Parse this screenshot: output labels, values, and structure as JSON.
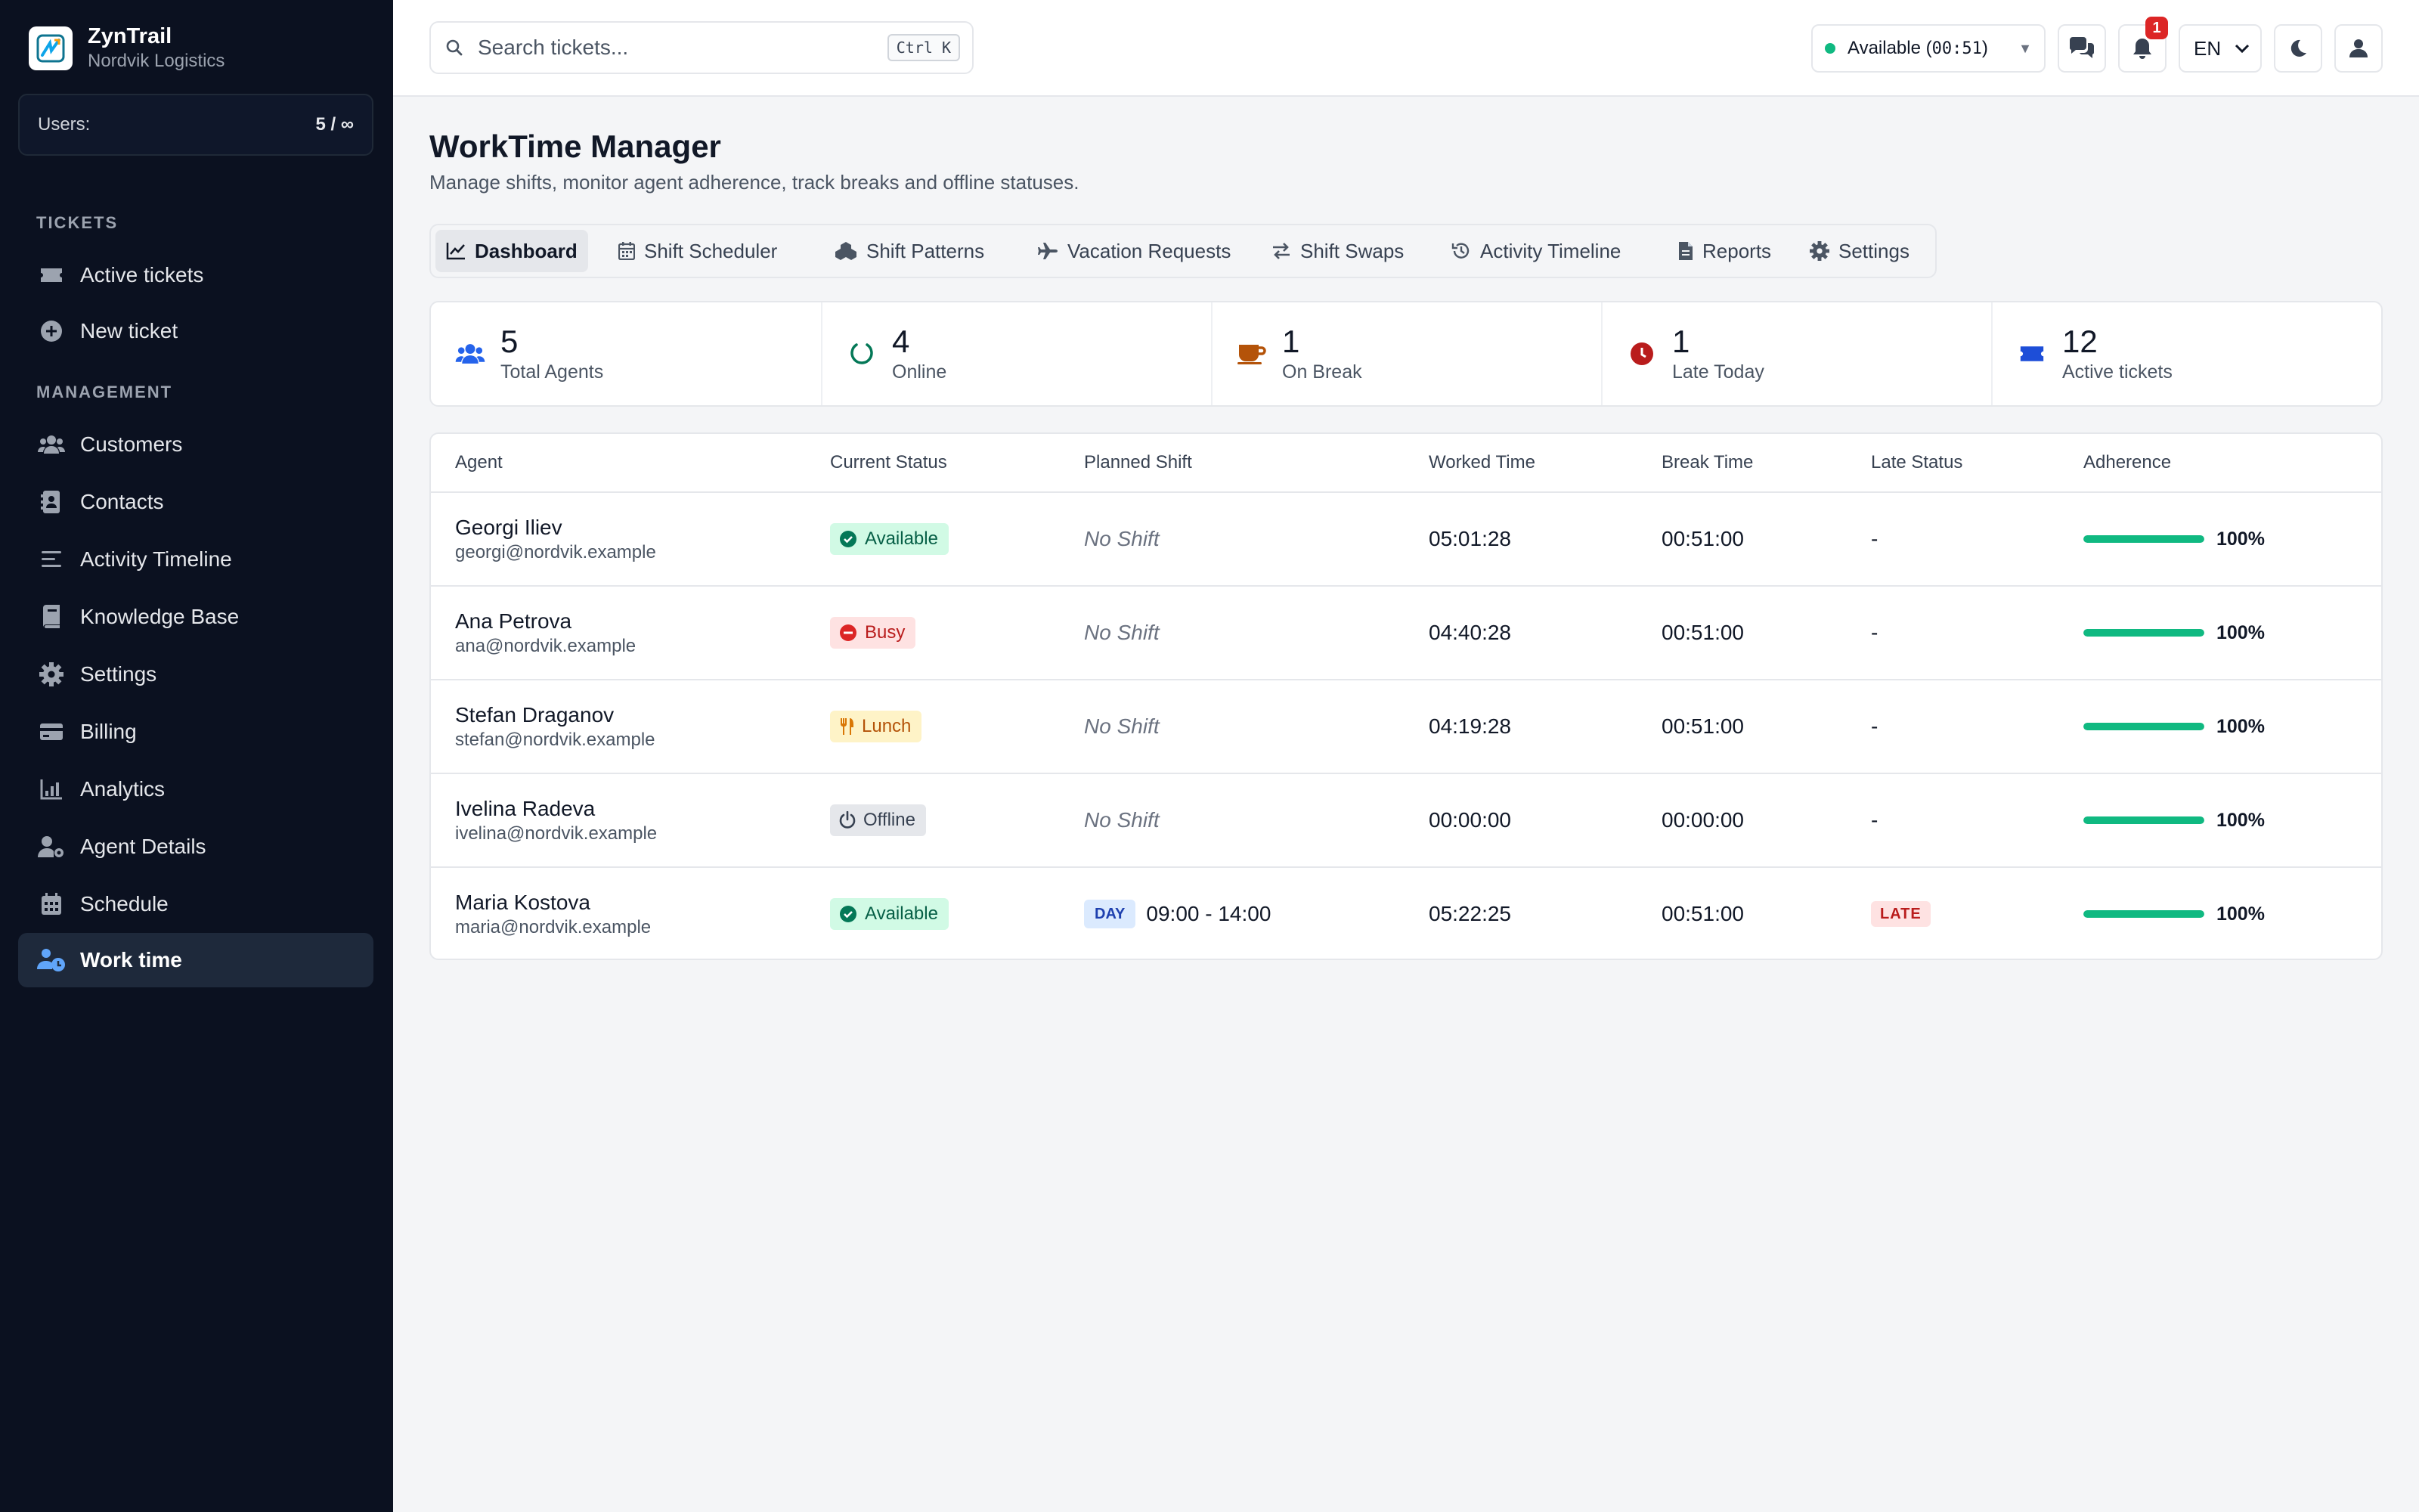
{
  "brand": {
    "name": "ZynTrail",
    "org": "Nordvik Logistics"
  },
  "users": {
    "label": "Users:",
    "value": "5 / ∞"
  },
  "sidebar": {
    "sections": [
      {
        "label": "TICKETS"
      },
      {
        "label": "MANAGEMENT"
      }
    ],
    "items": [
      {
        "label": "Active tickets",
        "icon": "ticket-icon"
      },
      {
        "label": "New ticket",
        "icon": "plus-circle-icon"
      },
      {
        "label": "Customers",
        "icon": "users-icon"
      },
      {
        "label": "Contacts",
        "icon": "contact-book-icon"
      },
      {
        "label": "Activity Timeline",
        "icon": "lines-icon"
      },
      {
        "label": "Knowledge Base",
        "icon": "book-icon"
      },
      {
        "label": "Settings",
        "icon": "gear-icon"
      },
      {
        "label": "Billing",
        "icon": "credit-card-icon"
      },
      {
        "label": "Analytics",
        "icon": "chart-icon"
      },
      {
        "label": "Agent Details",
        "icon": "user-gear-icon"
      },
      {
        "label": "Schedule",
        "icon": "calendar-icon"
      },
      {
        "label": "Work time",
        "icon": "users-clock-icon",
        "active": true
      }
    ]
  },
  "topbar": {
    "search_placeholder": "Search tickets...",
    "search_shortcut": "Ctrl K",
    "status_label": "Available (",
    "status_time": "00:51",
    "status_close": ")",
    "notifications_count": "1",
    "language": "EN"
  },
  "page": {
    "title": "WorkTime Manager",
    "subtitle": "Manage shifts, monitor agent adherence, track breaks and offline statuses."
  },
  "tabs": [
    {
      "label": "Dashboard",
      "icon": "line-chart-icon",
      "active": true
    },
    {
      "label": "Shift Scheduler",
      "icon": "calendar-icon"
    },
    {
      "label": "Shift Patterns",
      "icon": "cubes-icon"
    },
    {
      "label": "Vacation Requests",
      "icon": "plane-icon"
    },
    {
      "label": "Shift Swaps",
      "icon": "swap-icon"
    },
    {
      "label": "Activity Timeline",
      "icon": "history-icon"
    },
    {
      "label": "Reports",
      "icon": "file-icon"
    },
    {
      "label": "Settings",
      "icon": "gear-icon"
    }
  ],
  "stats": [
    {
      "value": "5",
      "label": "Total Agents",
      "icon": "users-icon",
      "color": "#2563eb"
    },
    {
      "value": "4",
      "label": "Online",
      "icon": "circle-notch-icon",
      "color": "#047857"
    },
    {
      "value": "1",
      "label": "On Break",
      "icon": "coffee-icon",
      "color": "#b45309"
    },
    {
      "value": "1",
      "label": "Late Today",
      "icon": "clock-icon",
      "color": "#b91c1c"
    },
    {
      "value": "12",
      "label": "Active tickets",
      "icon": "ticket-icon",
      "color": "#1d4ed8"
    }
  ],
  "table": {
    "headers": [
      "Agent",
      "Current Status",
      "Planned Shift",
      "Worked Time",
      "Break Time",
      "Late Status",
      "Adherence"
    ],
    "rows": [
      {
        "name": "Georgi Iliev",
        "email": "georgi@nordvik.example",
        "status": "Available",
        "status_type": "available",
        "shift": "No Shift",
        "worked": "05:01:28",
        "break": "00:51:00",
        "late": "-",
        "adherence": "100%",
        "adherence_value": 1.0
      },
      {
        "name": "Ana Petrova",
        "email": "ana@nordvik.example",
        "status": "Busy",
        "status_type": "busy",
        "shift": "No Shift",
        "worked": "04:40:28",
        "break": "00:51:00",
        "late": "-",
        "adherence": "100%",
        "adherence_value": 1.0
      },
      {
        "name": "Stefan Draganov",
        "email": "stefan@nordvik.example",
        "status": "Lunch",
        "status_type": "lunch",
        "shift": "No Shift",
        "worked": "04:19:28",
        "break": "00:51:00",
        "late": "-",
        "adherence": "100%",
        "adherence_value": 1.0
      },
      {
        "name": "Ivelina Radeva",
        "email": "ivelina@nordvik.example",
        "status": "Offline",
        "status_type": "offline",
        "shift": "No Shift",
        "worked": "00:00:00",
        "break": "00:00:00",
        "late": "-",
        "adherence": "100%",
        "adherence_value": 1.0
      },
      {
        "name": "Maria Kostova",
        "email": "maria@nordvik.example",
        "status": "Available",
        "status_type": "available",
        "shift_tag": "DAY",
        "shift": "09:00 - 14:00",
        "worked": "05:22:25",
        "break": "00:51:00",
        "late": "LATE",
        "adherence": "100%",
        "adherence_value": 1.0
      }
    ]
  },
  "colors": {
    "sidebar_bg": "#0b1120",
    "accent": "#10b981",
    "danger": "#dc2626"
  }
}
